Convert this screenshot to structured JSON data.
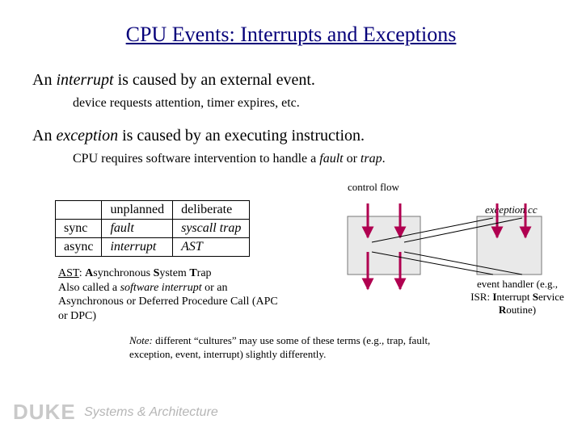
{
  "title": "CPU Events: Interrupts and Exceptions",
  "interrupt": {
    "pre": "An ",
    "term": "interrupt",
    "post": " is caused by an external event.",
    "sub": "device requests attention, timer expires, etc."
  },
  "exception": {
    "pre": "An ",
    "term": "exception",
    "post": " is caused by an executing instruction.",
    "sub_pre": "CPU requires software intervention to handle a ",
    "sub_fault": "fault",
    "sub_or": " or ",
    "sub_trap": "trap",
    "sub_dot": "."
  },
  "table": {
    "head": [
      "",
      "unplanned",
      "deliberate"
    ],
    "rows": [
      [
        "sync",
        "fault",
        "syscall trap"
      ],
      [
        "async",
        "interrupt",
        "AST"
      ]
    ]
  },
  "ast": {
    "term": "AST",
    "colon": ": ",
    "line1a": "",
    "line1b_a": "A",
    "line1b_b": "synchronous ",
    "line1b_s": "S",
    "line1b_c": "ystem ",
    "line1b_t": "T",
    "line1b_d": "rap",
    "line2a": "Also called a ",
    "line2em": "software interrupt",
    "line2b": " or an Asynchronous or Deferred Procedure Call (APC or DPC)"
  },
  "diagram": {
    "control_flow": "control flow",
    "exception_file": "exception.cc",
    "handler_pre": "event handler (e.g.,",
    "handler_isr1": "ISR: ",
    "handler_isr_i": "I",
    "handler_isr2": "nterrupt ",
    "handler_isr_s": "S",
    "handler_isr3": "ervice",
    "handler_isr_r": "R",
    "handler_isr4": "outine)"
  },
  "note": {
    "label": "Note: ",
    "text": "different “cultures” may use some of these terms (e.g., trap, fault, exception, event, interrupt) slightly differently."
  },
  "footer": {
    "duke": "DUKE",
    "sa": "Systems & Architecture"
  }
}
